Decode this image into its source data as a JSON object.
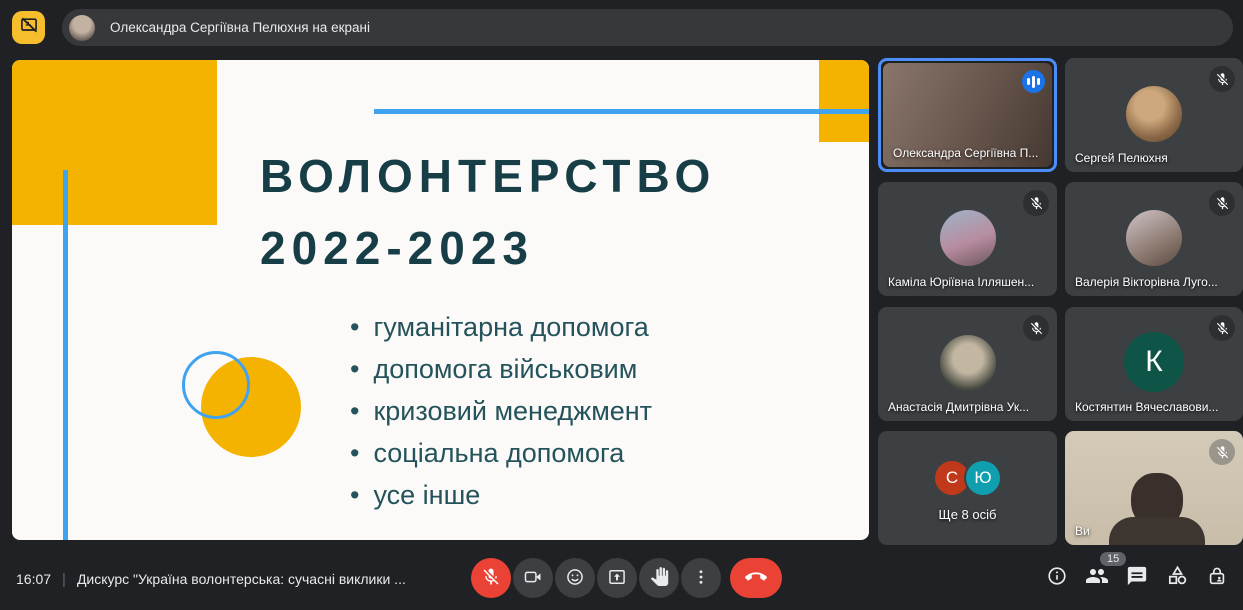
{
  "topbar": {
    "present_button_icon": "presentation-off-icon",
    "banner_text": "Олександра Сергіївна Пелюхня на екрані"
  },
  "slide": {
    "title_line1": "ВОЛОНТЕРСТВО",
    "title_line2": "2022-2023",
    "bullets": [
      "гуманітарна допомога",
      "допомога військовим",
      "кризовий менеджмент",
      "соціальна допомога",
      "усе інше"
    ]
  },
  "participants": [
    {
      "name": "Олександра Сергіївна П...",
      "type": "video",
      "speaking": true,
      "muted": false
    },
    {
      "name": "Сергей Пелюхня",
      "type": "photo-avatar",
      "muted": true
    },
    {
      "name": "Каміла Юріївна Ілляшен...",
      "type": "photo-avatar",
      "muted": true
    },
    {
      "name": "Валерія Вікторівна Луго...",
      "type": "photo-avatar",
      "muted": true
    },
    {
      "name": "Анастасія Дмитрівна Ук...",
      "type": "photo-avatar",
      "muted": true
    },
    {
      "name": "Костянтин Вячеславови...",
      "type": "initial-avatar",
      "initial": "К",
      "avatar_color": "#0E5447",
      "muted": true
    },
    {
      "name": "Ще 8 осіб",
      "type": "overflow",
      "initials": [
        {
          "letter": "С",
          "color": "#C0391B"
        },
        {
          "letter": "Ю",
          "color": "#0F9FAE"
        }
      ]
    },
    {
      "name": "Ви",
      "type": "video",
      "muted": true
    }
  ],
  "bottom_bar": {
    "time": "16:07",
    "meeting_title": "Дискурс \"Україна волонтерська: сучасні виклики ...",
    "controls": [
      "mic-off",
      "camera",
      "reactions",
      "present-screen",
      "raise-hand",
      "more-options",
      "end-call"
    ],
    "right_icons": [
      "info",
      "people",
      "chat",
      "activities",
      "host-controls"
    ],
    "participant_count": "15"
  },
  "colors": {
    "background": "#202124",
    "tile": "#3C4043",
    "slide_yellow": "#F5B301",
    "slide_blue": "#3FA3F0",
    "slide_title": "#173E47",
    "active_tile_border": "#4C8DF7",
    "audio_indicator": "#1A73E8",
    "danger_red": "#EA4335",
    "present_button_yellow": "#F6BE2C"
  }
}
